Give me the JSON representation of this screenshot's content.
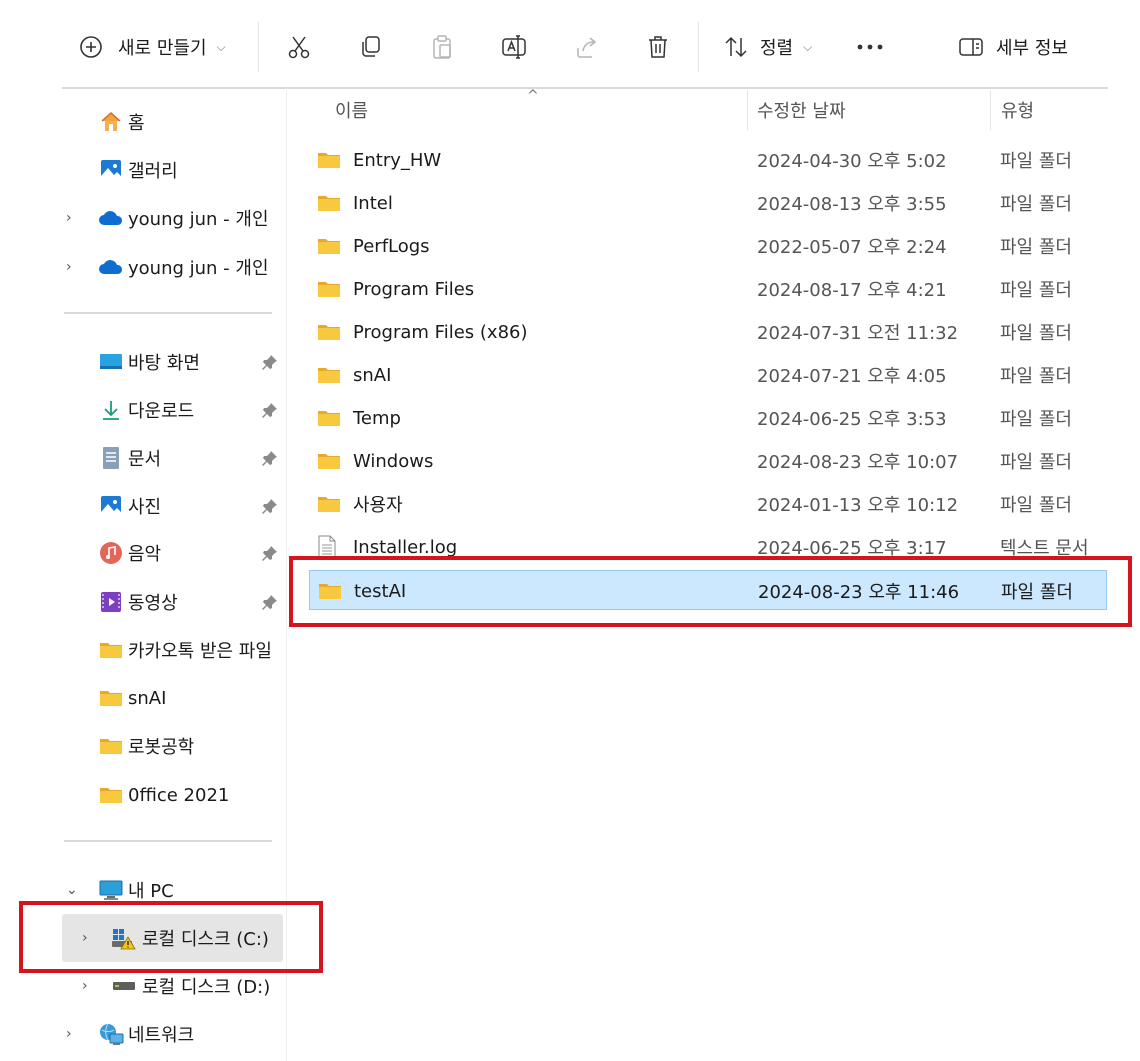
{
  "toolbar": {
    "new_label": "새로 만들기",
    "sort_label": "정렬",
    "details_label": "세부 정보",
    "icons": [
      "add-circle-icon",
      "cut-icon",
      "copy-icon",
      "paste-icon",
      "rename-icon",
      "share-icon",
      "delete-icon",
      "sort-icon",
      "more-icon",
      "details-pane-icon"
    ]
  },
  "sidebar": {
    "quick": [
      {
        "label": "홈",
        "icon": "home-icon"
      },
      {
        "label": "갤러리",
        "icon": "gallery-icon"
      },
      {
        "label": "young jun - 개인",
        "icon": "onedrive-icon"
      },
      {
        "label": "young jun - 개인",
        "icon": "onedrive-icon"
      }
    ],
    "pinned": [
      {
        "label": "바탕 화면",
        "icon": "desktop-icon"
      },
      {
        "label": "다운로드",
        "icon": "download-icon"
      },
      {
        "label": "문서",
        "icon": "document-icon"
      },
      {
        "label": "사진",
        "icon": "pictures-icon"
      },
      {
        "label": "음악",
        "icon": "music-icon"
      },
      {
        "label": "동영상",
        "icon": "video-icon"
      }
    ],
    "folders": [
      {
        "label": "카카오톡 받은 파일"
      },
      {
        "label": "snAI"
      },
      {
        "label": "로봇공학"
      },
      {
        "label": "0ffice 2021"
      }
    ],
    "this_pc": "내 PC",
    "drive_c": "로컬 디스크 (C:)",
    "drive_d": "로컬 디스크 (D:)",
    "network": "네트워크"
  },
  "columns": {
    "name": "이름",
    "date": "수정한 날짜",
    "type": "유형"
  },
  "files": [
    {
      "name": "Entry_HW",
      "date": "2024-04-30 오후 5:02",
      "type": "파일 폴더",
      "kind": "folder"
    },
    {
      "name": "Intel",
      "date": "2024-08-13 오후 3:55",
      "type": "파일 폴더",
      "kind": "folder"
    },
    {
      "name": "PerfLogs",
      "date": "2022-05-07 오후 2:24",
      "type": "파일 폴더",
      "kind": "folder"
    },
    {
      "name": "Program Files",
      "date": "2024-08-17 오후 4:21",
      "type": "파일 폴더",
      "kind": "folder"
    },
    {
      "name": "Program Files (x86)",
      "date": "2024-07-31 오전 11:32",
      "type": "파일 폴더",
      "kind": "folder"
    },
    {
      "name": "snAI",
      "date": "2024-07-21 오후 4:05",
      "type": "파일 폴더",
      "kind": "folder"
    },
    {
      "name": "Temp",
      "date": "2024-06-25 오후 3:53",
      "type": "파일 폴더",
      "kind": "folder"
    },
    {
      "name": "Windows",
      "date": "2024-08-23 오후 10:07",
      "type": "파일 폴더",
      "kind": "folder"
    },
    {
      "name": "사용자",
      "date": "2024-01-13 오후 10:12",
      "type": "파일 폴더",
      "kind": "folder"
    },
    {
      "name": "Installer.log",
      "date": "2024-06-25 오후 3:17",
      "type": "텍스트 문서",
      "kind": "text"
    },
    {
      "name": "testAI",
      "date": "2024-08-23 오후 11:46",
      "type": "파일 폴더",
      "kind": "folder",
      "selected": true
    }
  ],
  "colors": {
    "accent_selection": "#cce8ff",
    "highlight_box": "#d6141d",
    "folder": "#f8c93e"
  }
}
